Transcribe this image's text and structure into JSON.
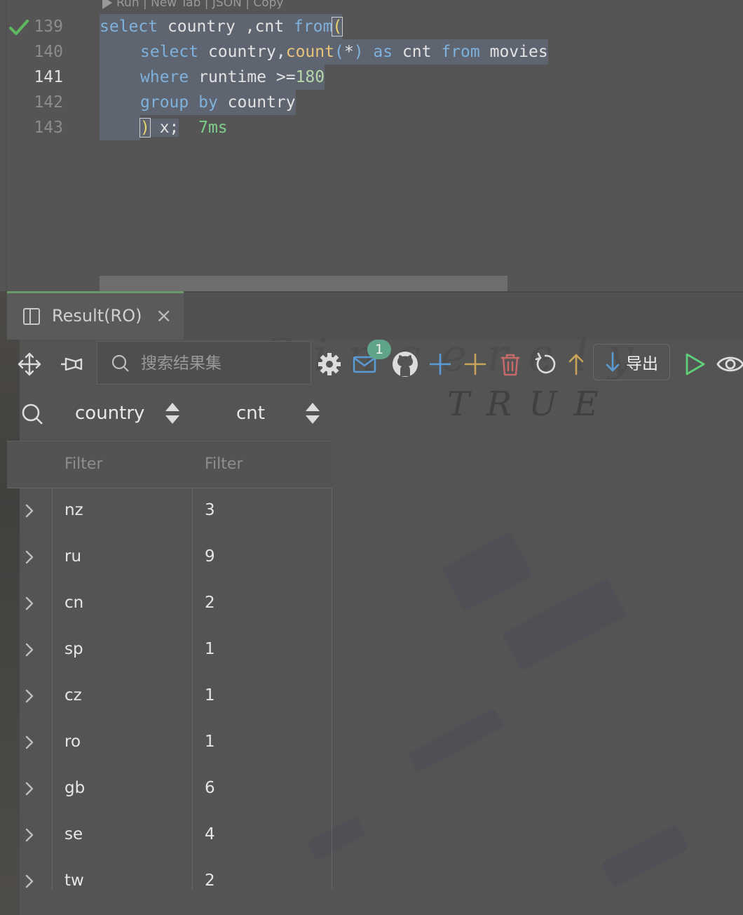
{
  "editor": {
    "codelens": "Run | New Tab | JSON | Copy",
    "lines": [
      {
        "num": "139"
      },
      {
        "num": "140"
      },
      {
        "num": "141"
      },
      {
        "num": "142"
      },
      {
        "num": "143"
      }
    ],
    "line139": {
      "kw1": "select",
      "t1": " country ,cnt ",
      "kw2": "from",
      "p": "("
    },
    "line140": {
      "kw1": "select",
      "t1": " country,",
      "fn": "count",
      "p1": "(",
      "star": "*",
      "p2": ")",
      "t2": " ",
      "kw2": "as",
      "t3": " cnt ",
      "kw3": "from",
      "t4": " movies"
    },
    "line141": {
      "kw1": "where",
      "t1": " runtime >=",
      "num": "180"
    },
    "line142": {
      "kw1": "group",
      "t0": " ",
      "kw2": "by",
      "t1": " country"
    },
    "line143": {
      "p": ")",
      "t1": " x;",
      "time": "7ms"
    }
  },
  "result": {
    "tab_label": "Result(RO)",
    "close_label": "×",
    "search_placeholder": "搜索结果集",
    "badge_count": "1",
    "export_label": "导出",
    "columns": [
      "country",
      "cnt"
    ],
    "filter_placeholder": "Filter",
    "rows": [
      {
        "country": "nz",
        "cnt": "3"
      },
      {
        "country": "ru",
        "cnt": "9"
      },
      {
        "country": "cn",
        "cnt": "2"
      },
      {
        "country": "sp",
        "cnt": "1"
      },
      {
        "country": "cz",
        "cnt": "1"
      },
      {
        "country": "ro",
        "cnt": "1"
      },
      {
        "country": "gb",
        "cnt": "6"
      },
      {
        "country": "se",
        "cnt": "4"
      },
      {
        "country": "tw",
        "cnt": "2"
      }
    ]
  },
  "watermark": {
    "script": "Sincerely",
    "word": "TRUE"
  },
  "colors": {
    "success_check": "#5fb85f",
    "keyword": "#7eb2dd",
    "function": "#e8c47a",
    "number": "#b6d7a8",
    "time": "#7fcf8a",
    "badge": "#5fa489",
    "run": "#5fcf7a",
    "add": "#5b9bd5",
    "add_alt": "#c9a35a",
    "delete": "#c96a6a",
    "export_arrow": "#5b9bd5"
  }
}
